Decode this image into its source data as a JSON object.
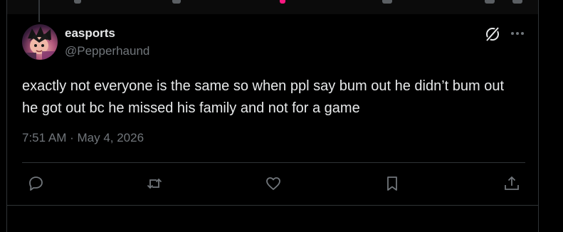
{
  "post": {
    "author": {
      "display_name": "easports",
      "handle": "@Pepperhaund"
    },
    "text": "exactly not everyone is the same so when ppl say bum out he didn’t bum out he got out bc he missed his family and not for a game",
    "timestamp": "7:51 AM · May 4, 2026",
    "actions": [
      {
        "name": "reply",
        "icon": "reply-icon"
      },
      {
        "name": "repost",
        "icon": "repost-icon"
      },
      {
        "name": "like",
        "icon": "heart-icon"
      },
      {
        "name": "bookmark",
        "icon": "bookmark-icon"
      },
      {
        "name": "share",
        "icon": "share-icon"
      }
    ],
    "header_icons": [
      "grok-icon",
      "more-icon"
    ]
  },
  "colors": {
    "background": "#000000",
    "text_primary": "#e7e9ea",
    "text_secondary": "#71767b",
    "border": "#2f3336"
  }
}
